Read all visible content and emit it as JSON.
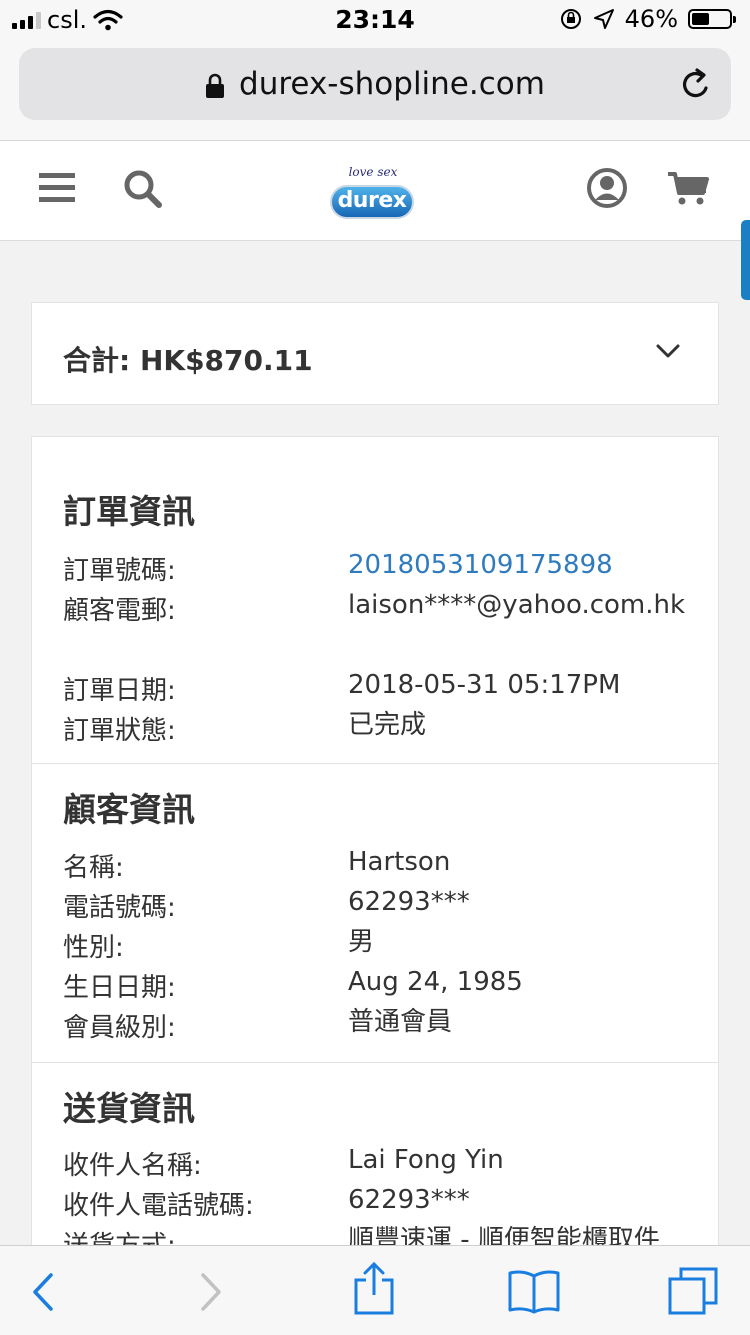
{
  "status_bar": {
    "carrier": "csl.",
    "time": "23:14",
    "battery": "46%",
    "battery_level": 0.46,
    "icons": [
      "signal-icon",
      "wifi-icon",
      "rotation-lock-icon",
      "location-icon",
      "battery-icon"
    ]
  },
  "browser": {
    "url": "durex-shopline.com",
    "icons": [
      "lock-icon",
      "reload-icon"
    ]
  },
  "header": {
    "logo_tagline": "love sex",
    "logo_brand": "durex",
    "icons": [
      "menu-icon",
      "search-icon",
      "account-icon",
      "cart-icon"
    ]
  },
  "total": {
    "label": "合計: HK$870.11"
  },
  "order_info": {
    "title": "訂單資訊",
    "rows": [
      {
        "label": "訂單號碼:",
        "value": "2018053109175898"
      },
      {
        "label": "顧客電郵:",
        "value": "laison****@yahoo.com.hk"
      },
      {
        "label": "訂單日期:",
        "value": "2018-05-31 05:17PM"
      },
      {
        "label": "訂單狀態:",
        "value": "已完成"
      }
    ]
  },
  "customer_info": {
    "title": "顧客資訊",
    "rows": [
      {
        "label": "名稱:",
        "value": "Hartson"
      },
      {
        "label": "電話號碼:",
        "value": "62293***"
      },
      {
        "label": "性別:",
        "value": "男"
      },
      {
        "label": "生日日期:",
        "value": "Aug 24, 1985"
      },
      {
        "label": "會員級別:",
        "value": "普通會員"
      }
    ]
  },
  "delivery_info": {
    "title": "送貨資訊",
    "rows": [
      {
        "label": "收件人名稱:",
        "value": "Lai Fong Yin"
      },
      {
        "label": "收件人電話號碼:",
        "value": "62293***"
      },
      {
        "label": "送貨方式:",
        "value": "順豐速運 - 順便智能櫃取件"
      }
    ]
  },
  "toolbar": {
    "icons": [
      "back-icon",
      "forward-icon",
      "share-icon",
      "bookmarks-icon",
      "tabs-icon"
    ]
  },
  "colors": {
    "link": "#2f7bbd",
    "toolbar_blue": "#1a7ee0",
    "accent_blue": "#1b7fc4"
  }
}
